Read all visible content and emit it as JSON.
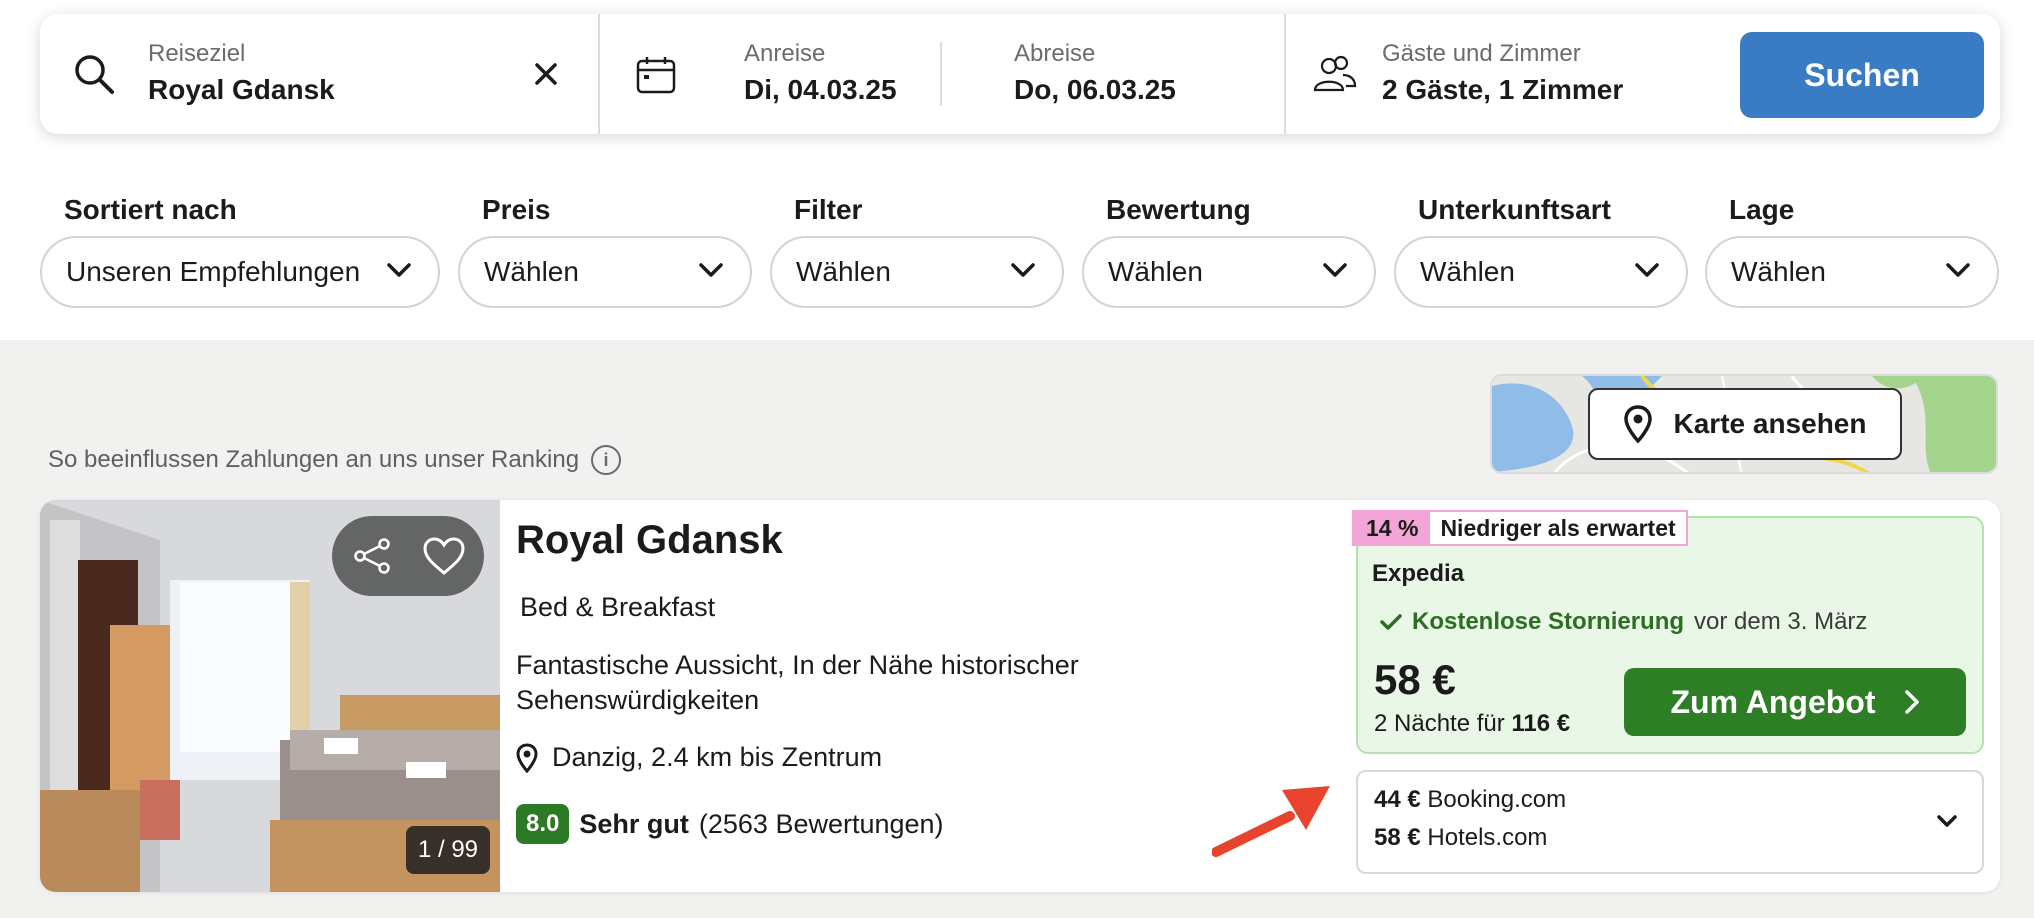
{
  "search": {
    "destination_label": "Reiseziel",
    "destination_value": "Royal Gdansk",
    "checkin_label": "Anreise",
    "checkin_value": "Di, 04.03.25",
    "checkout_label": "Abreise",
    "checkout_value": "Do, 06.03.25",
    "guests_label": "Gäste und Zimmer",
    "guests_value": "2 Gäste, 1 Zimmer",
    "search_button": "Suchen",
    "icons": [
      "search-icon",
      "clear-icon",
      "calendar-icon",
      "users-icon"
    ]
  },
  "filters": [
    {
      "label": "Sortiert nach",
      "value": "Unseren Empfehlungen"
    },
    {
      "label": "Preis",
      "value": "Wählen"
    },
    {
      "label": "Filter",
      "value": "Wählen"
    },
    {
      "label": "Bewertung",
      "value": "Wählen"
    },
    {
      "label": "Unterkunftsart",
      "value": "Wählen"
    },
    {
      "label": "Lage",
      "value": "Wählen"
    }
  ],
  "ranking_note": "So beeinflussen Zahlungen an uns unser Ranking",
  "map_button": "Karte ansehen",
  "hotel": {
    "name": "Royal Gdansk",
    "type": "Bed & Breakfast",
    "description": "Fantastische Aussicht, In der Nähe historischer Sehenswürdigkeiten",
    "location": "Danzig, 2.4 km bis Zentrum",
    "score": "8.0",
    "rating_word": "Sehr gut",
    "review_count": "(2563 Bewertungen)",
    "photo_counter": "1 / 99",
    "deal_percent": "14 %",
    "deal_text": "Niedriger als erwartet",
    "provider": "Expedia",
    "cancellation_bold": "Kostenlose Stornierung",
    "cancellation_rest": "vor dem 3. März",
    "price": "58 €",
    "total_prefix": "2 Nächte für",
    "total_value": "116 €",
    "deal_button": "Zum Angebot",
    "alternatives": [
      {
        "price": "44 €",
        "provider": "Booking.com"
      },
      {
        "price": "58 €",
        "provider": "Hotels.com"
      }
    ]
  },
  "colors": {
    "primary_blue": "#3a7cc3",
    "deal_green": "#2e7e25",
    "offer_bg": "#e9f7e7",
    "deal_pink": "#f2a5d6",
    "arrow_red": "#e8432d"
  }
}
